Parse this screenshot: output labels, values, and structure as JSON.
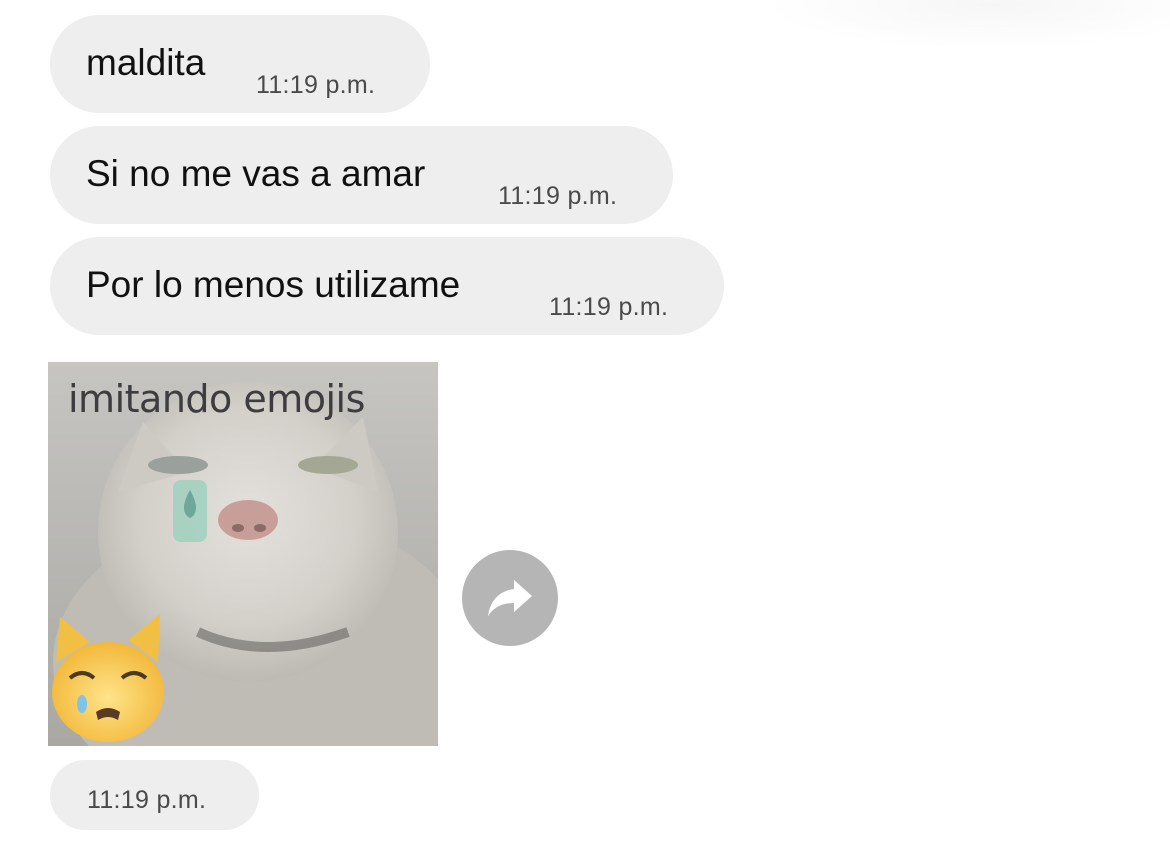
{
  "messages": [
    {
      "text": "maldita",
      "time": "11:19 p.m."
    },
    {
      "text": "Si no me vas a amar",
      "time": "11:19 p.m."
    },
    {
      "text": "Por lo menos utilizame",
      "time": "11:19 p.m."
    }
  ],
  "media_message": {
    "caption": "imitando emojis",
    "time": "11:19 p.m."
  },
  "share": {
    "icon": "share-arrow-icon"
  },
  "colors": {
    "bubble": "#eeeeee",
    "share_button": "#b5b5b5",
    "timestamp": "#4a4a4a"
  }
}
